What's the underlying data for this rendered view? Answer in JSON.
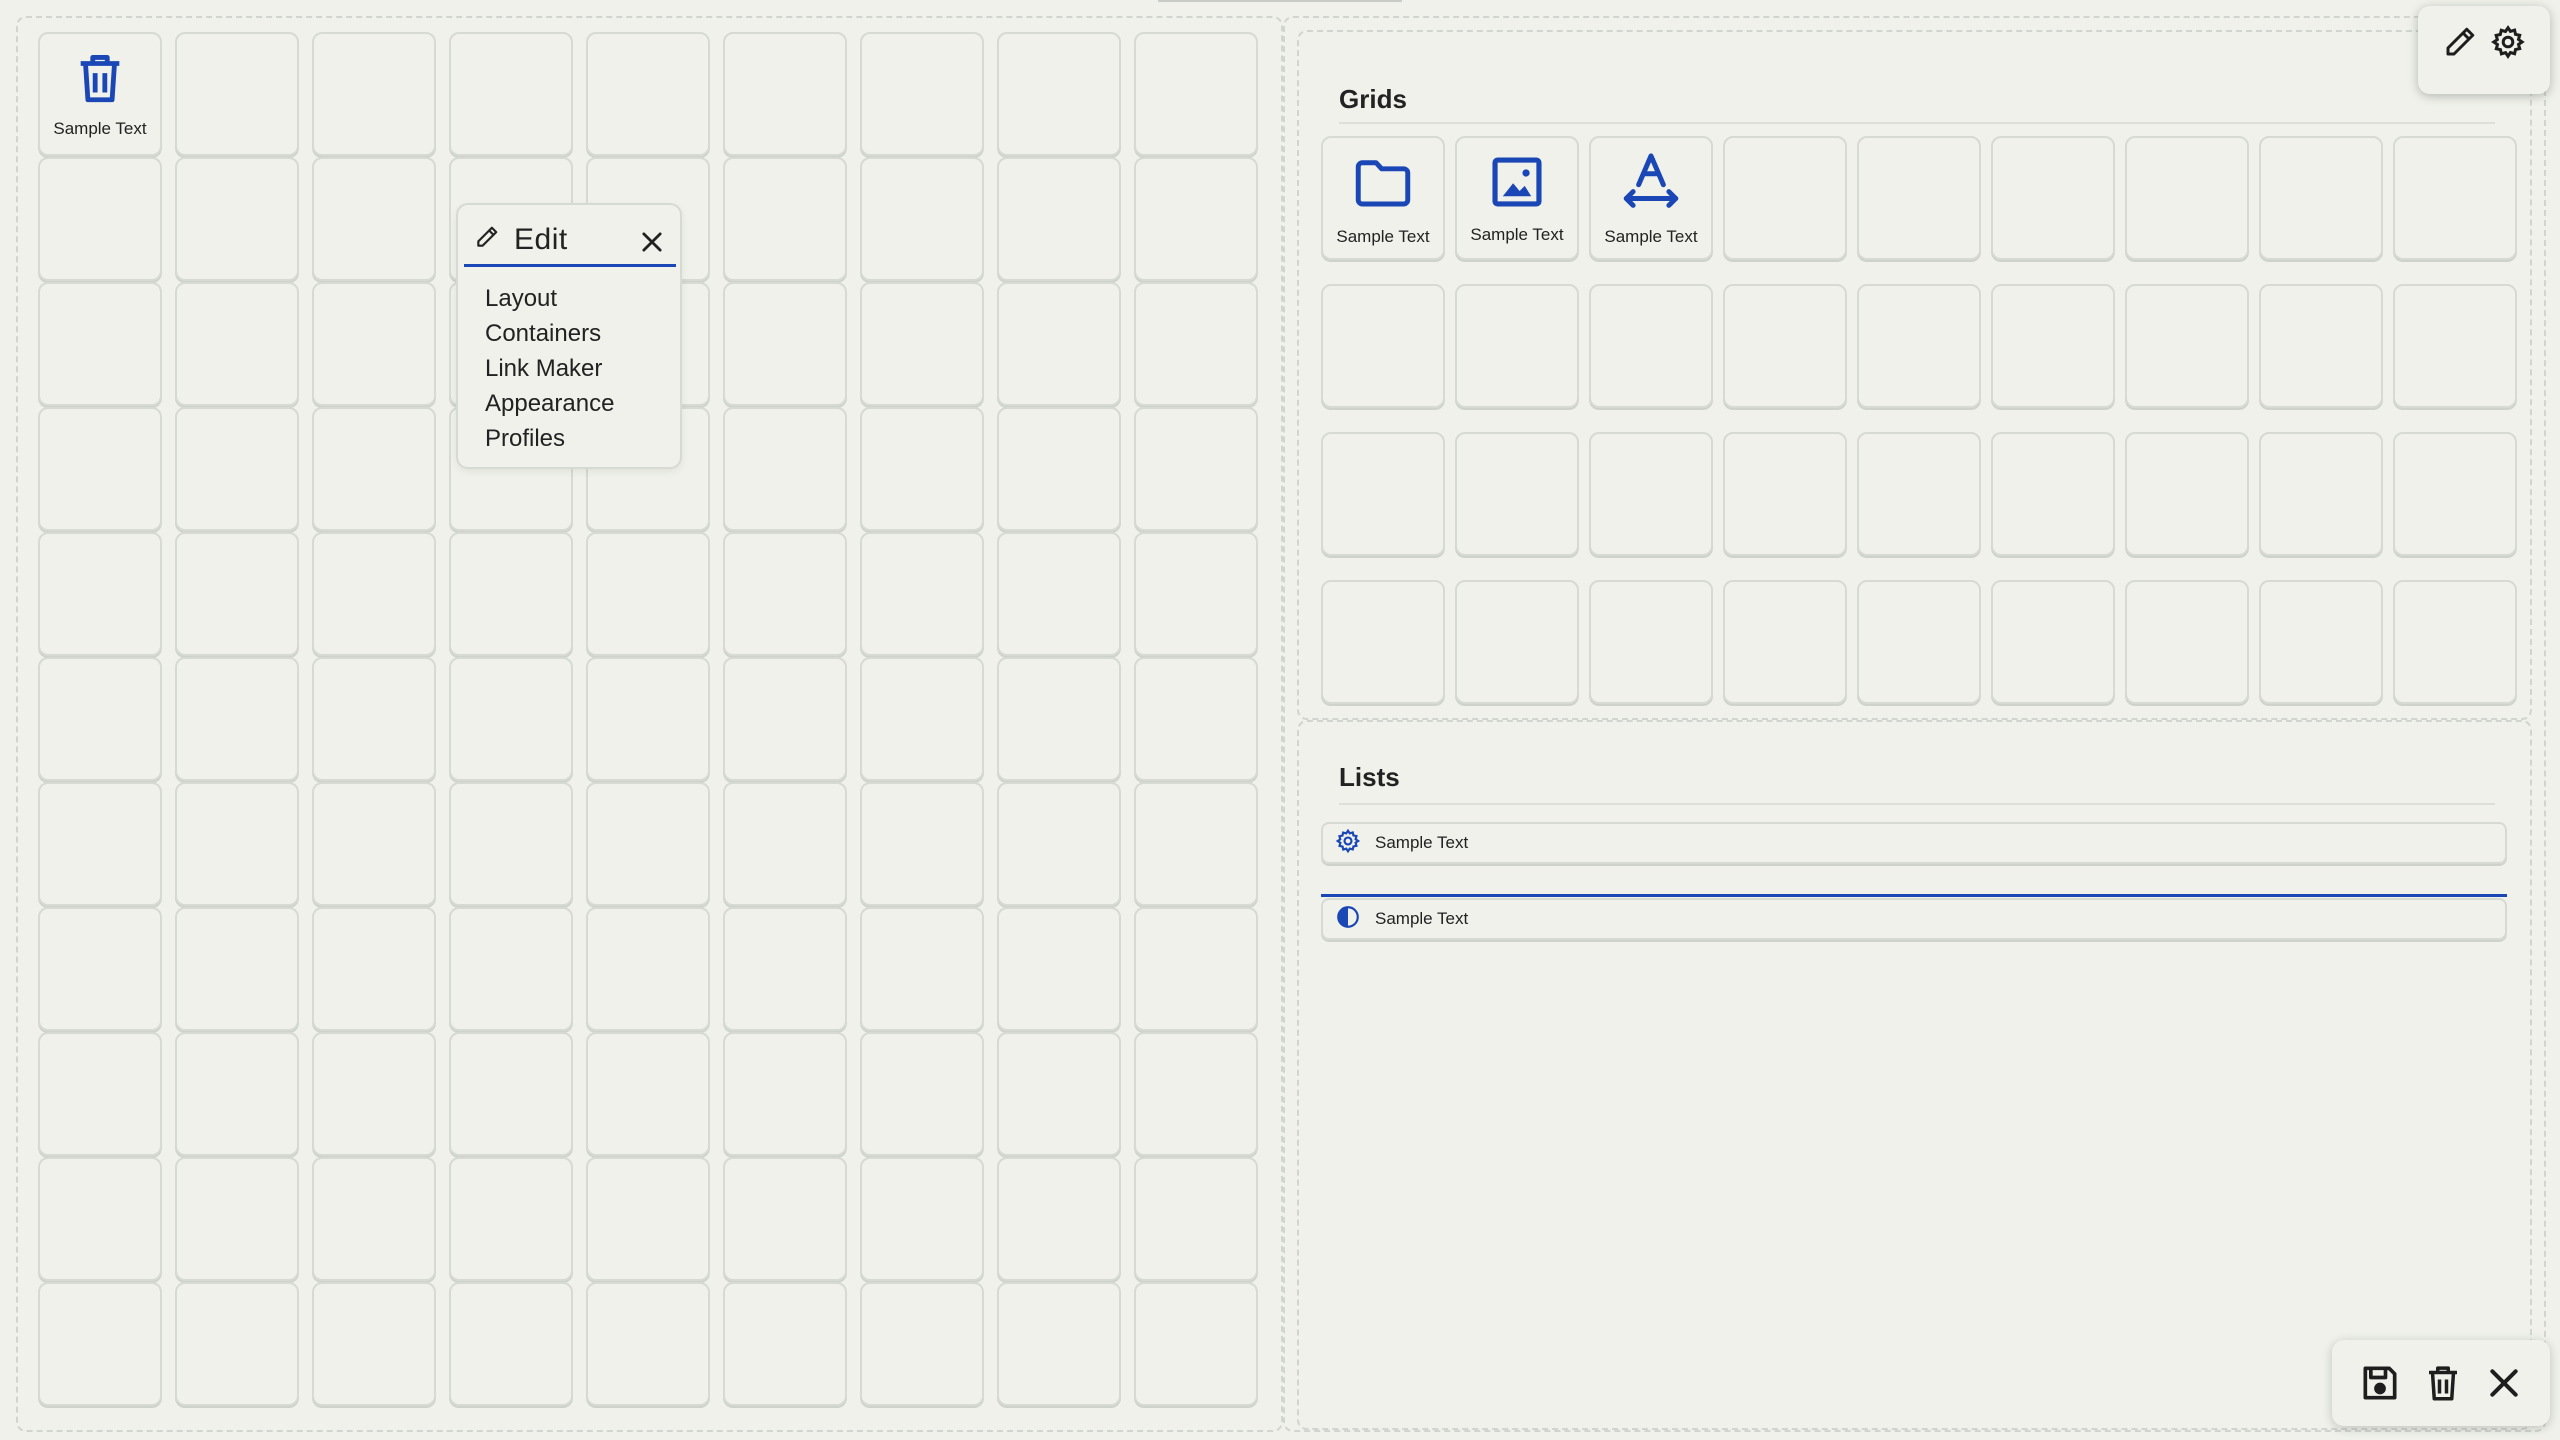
{
  "colors": {
    "background": "#eff1ea",
    "accent": "#1a47b5",
    "cell_border": "#d7d9d3",
    "text": "#222222"
  },
  "left_grid": {
    "rows": 11,
    "columns": 9,
    "tiles": [
      {
        "index": 0,
        "icon": "trash-icon",
        "label": "Sample Text"
      }
    ]
  },
  "edit_menu": {
    "title": "Edit",
    "items": [
      "Layout",
      "Containers",
      "Link Maker",
      "Appearance",
      "Profiles"
    ]
  },
  "grids_section": {
    "title": "Grids",
    "rows": 4,
    "columns": 9,
    "tiles": [
      {
        "index": 0,
        "icon": "folder-icon",
        "label": "Sample Text"
      },
      {
        "index": 1,
        "icon": "image-icon",
        "label": "Sample Text"
      },
      {
        "index": 2,
        "icon": "text-width-icon",
        "label": "Sample Text"
      }
    ]
  },
  "lists_section": {
    "title": "Lists",
    "items": [
      {
        "icon": "gear-icon",
        "label": "Sample Text"
      },
      {
        "icon": "contrast-icon",
        "label": "Sample Text"
      }
    ]
  },
  "top_toolbar": {
    "icons": [
      "pencil-icon",
      "gear-icon"
    ]
  },
  "bottom_toolbar": {
    "icons": [
      "save-icon",
      "trash-icon",
      "close-icon"
    ]
  }
}
